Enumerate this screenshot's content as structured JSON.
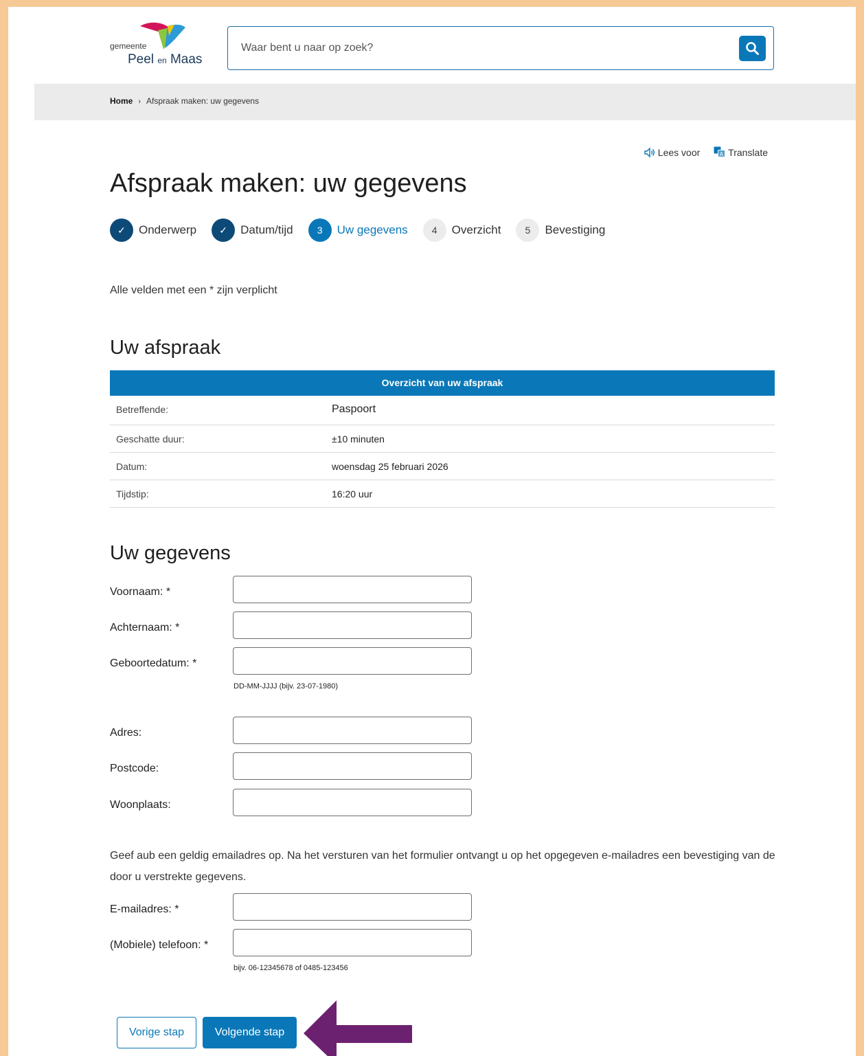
{
  "header": {
    "logo_small": "gemeente",
    "logo_name_1": "Peel",
    "logo_name_en": "en",
    "logo_name_2": "Maas",
    "search_placeholder": "Waar bent u naar op zoek?"
  },
  "breadcrumb": {
    "home": "Home",
    "separator": "›",
    "current": "Afspraak maken: uw gegevens"
  },
  "tools": {
    "read_aloud": "Lees voor",
    "translate": "Translate"
  },
  "page_title": "Afspraak maken: uw gegevens",
  "steps": [
    {
      "marker": "✓",
      "label": "Onderwerp",
      "state": "done"
    },
    {
      "marker": "✓",
      "label": "Datum/tijd",
      "state": "done"
    },
    {
      "marker": "3",
      "label": "Uw gegevens",
      "state": "active"
    },
    {
      "marker": "4",
      "label": "Overzicht",
      "state": "todo"
    },
    {
      "marker": "5",
      "label": "Bevestiging",
      "state": "todo"
    }
  ],
  "required_note": "Alle velden met een * zijn verplicht",
  "appointment": {
    "heading": "Uw afspraak",
    "table_header": "Overzicht van uw afspraak",
    "rows": [
      {
        "key": "Betreffende:",
        "value": "Paspoort"
      },
      {
        "key": "Geschatte duur:",
        "value": "±10 minuten"
      },
      {
        "key": "Datum:",
        "value": "woensdag 25 februari 2026"
      },
      {
        "key": "Tijdstip:",
        "value": "16:20 uur"
      }
    ]
  },
  "details": {
    "heading": "Uw gegevens",
    "fields": {
      "first_name": {
        "label": "Voornaam: *",
        "value": ""
      },
      "last_name": {
        "label": "Achternaam: *",
        "value": ""
      },
      "birth_date": {
        "label": "Geboortedatum: *",
        "value": "",
        "hint": "DD-MM-JJJJ (bijv. 23-07-1980)"
      },
      "address": {
        "label": "Adres:",
        "value": ""
      },
      "postal_code": {
        "label": "Postcode:",
        "value": ""
      },
      "city": {
        "label": "Woonplaats:",
        "value": ""
      },
      "email": {
        "label": "E-mailadres: *",
        "value": ""
      },
      "phone": {
        "label": "(Mobiele) telefoon: *",
        "value": "",
        "hint": "bijv. 06-12345678 of 0485-123456"
      }
    },
    "email_note": "Geef aub een geldig emailadres op. Na het versturen van het formulier ontvangt u op het opgegeven e-mailadres een bevestiging van de door u verstrekte gegevens."
  },
  "actions": {
    "previous": "Vorige stap",
    "next": "Volgende stap"
  },
  "colors": {
    "primary": "#0a78b8",
    "step_done": "#0d4a78",
    "frame": "#f6c996",
    "annotation_arrow": "#6b2170"
  }
}
